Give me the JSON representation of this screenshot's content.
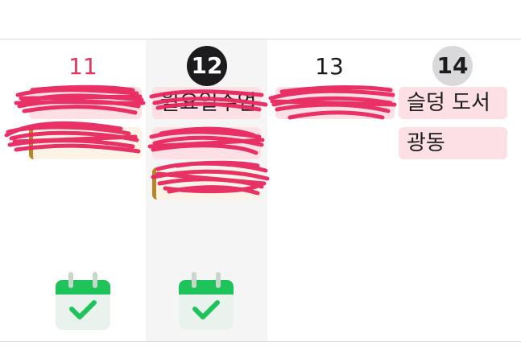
{
  "days": [
    {
      "number": "11",
      "style": "sunday"
    },
    {
      "number": "12",
      "style": "today"
    },
    {
      "number": "13",
      "style": "normal"
    },
    {
      "number": "14",
      "style": "selected"
    }
  ],
  "events": {
    "day11": [
      {
        "title": "",
        "kind": "redacted"
      },
      {
        "title": "",
        "kind": "redacted"
      }
    ],
    "day12": [
      {
        "title": "월요일수업",
        "kind": "partially-redacted"
      },
      {
        "title": "",
        "kind": "redacted"
      },
      {
        "title": "",
        "kind": "redacted"
      }
    ],
    "day13": [
      {
        "title": "",
        "kind": "redacted"
      }
    ],
    "day14": [
      {
        "title": "슬덩 도서",
        "kind": "event"
      },
      {
        "title": "광동",
        "kind": "event"
      }
    ]
  },
  "todo_icon": "calendar-check-icon",
  "colors": {
    "accent_red": "#e0385d",
    "today_circle": "#1c1c1e",
    "selected_circle": "#d9d9dc",
    "event_pink": "#fde0e6",
    "event_cream": "#fbf3e6",
    "event_bar": "#b8862a",
    "scribble": "#e8275f",
    "todo_green": "#1ec35a"
  }
}
